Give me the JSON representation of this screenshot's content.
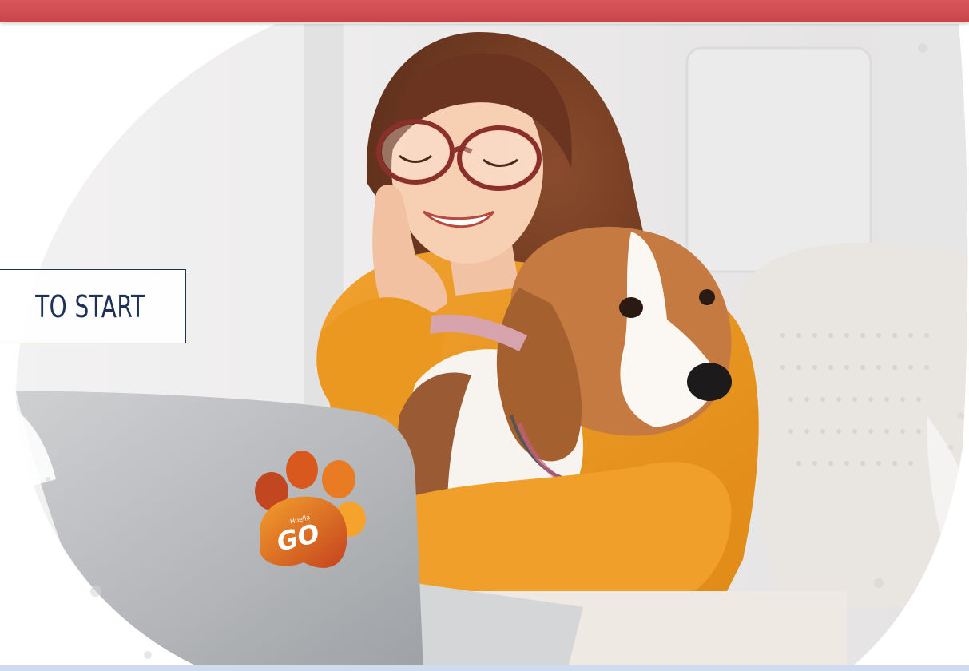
{
  "header": {
    "bar_color": "#d0494d"
  },
  "main": {
    "start_button_label": "TO START",
    "start_button_color": "#1f3157"
  },
  "laptop_sticker": {
    "brand_small": "Huella",
    "brand_large": "GO",
    "colors": [
      "#e96a1d",
      "#c7431f",
      "#f5a02a"
    ]
  },
  "hero_image": {
    "subject": "woman-with-beagle-at-laptop",
    "icon": "paw-logo-icon"
  },
  "footer": {
    "bar_color": "#cfdcef"
  }
}
